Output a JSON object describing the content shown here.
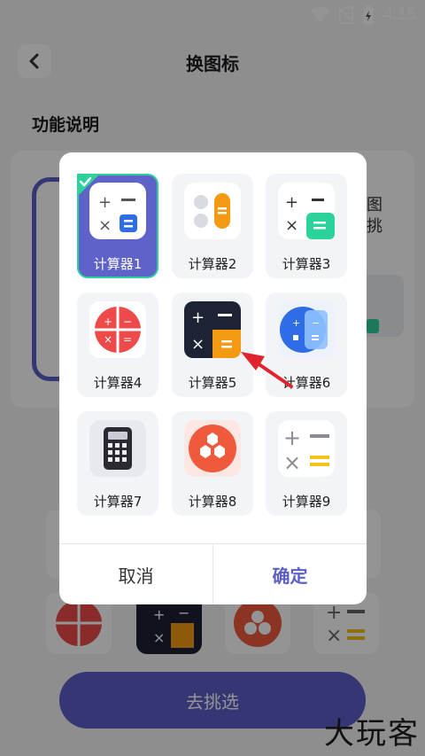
{
  "status_bar": {
    "time": "4:15"
  },
  "page": {
    "title": "换图标",
    "section_title": "功能说明",
    "side_text_line1": "图",
    "side_text_line2": "挑",
    "pick_button": "去挑选"
  },
  "dialog": {
    "icons": [
      {
        "label": "计算器1",
        "selected": true
      },
      {
        "label": "计算器2",
        "selected": false
      },
      {
        "label": "计算器3",
        "selected": false
      },
      {
        "label": "计算器4",
        "selected": false
      },
      {
        "label": "计算器5",
        "selected": false
      },
      {
        "label": "计算器6",
        "selected": false
      },
      {
        "label": "计算器7",
        "selected": false
      },
      {
        "label": "计算器8",
        "selected": false
      },
      {
        "label": "计算器9",
        "selected": false
      }
    ],
    "cancel_label": "取消",
    "confirm_label": "确定"
  },
  "watermark": "大玩客",
  "colors": {
    "accent": "#5b5fc7",
    "selected_border": "#2bd39b",
    "arrow": "#e0242c"
  }
}
